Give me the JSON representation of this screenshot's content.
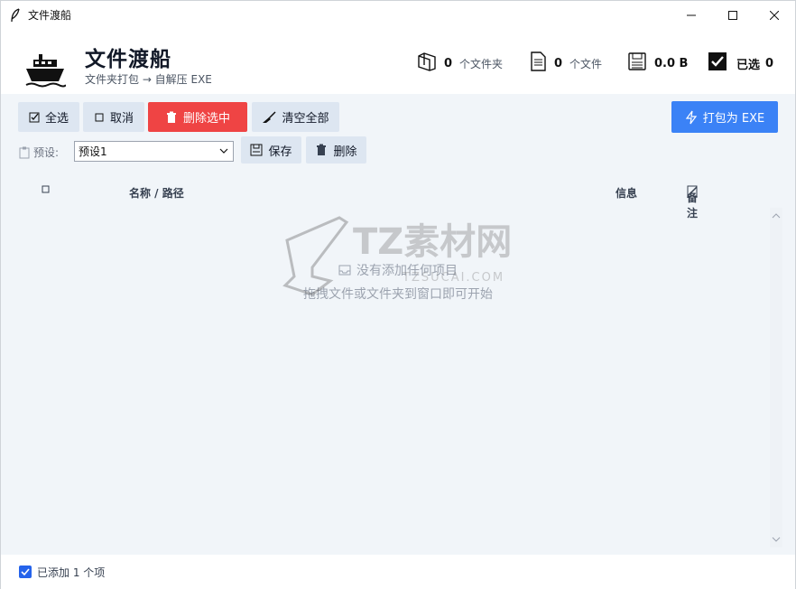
{
  "window": {
    "title": "文件渡船"
  },
  "header": {
    "title": "文件渡船",
    "subtitle": "文件夹打包 → 自解压 EXE",
    "stats": {
      "folders": {
        "value": "0",
        "label": "个文件夹"
      },
      "files": {
        "value": "0",
        "label": "个文件"
      },
      "size": {
        "value": "0.0 B"
      },
      "selected": {
        "label": "已选",
        "value": "0"
      }
    }
  },
  "toolbar": {
    "select_all": "全选",
    "deselect": "取消",
    "delete_selected": "删除选中",
    "clear_all": "清空全部",
    "pack_exe": "打包为 EXE"
  },
  "preset": {
    "label": "预设:",
    "value": "预设1",
    "save": "保存",
    "delete": "删除"
  },
  "table": {
    "columns": {
      "name": "名称 / 路径",
      "info": "信息",
      "note": "备注"
    }
  },
  "empty_state": {
    "title": "没有添加任何项目",
    "hint": "拖拽文件或文件夹到窗口即可开始"
  },
  "watermark": {
    "text": "TZ素材网",
    "sub": "TZSUCAI.COM"
  },
  "footer": {
    "status": "已添加 1 个项"
  },
  "colors": {
    "accent": "#3b82f6",
    "danger": "#ef4444",
    "toolbar_bg": "#f1f5f9",
    "button_bg": "#dde6f1"
  }
}
